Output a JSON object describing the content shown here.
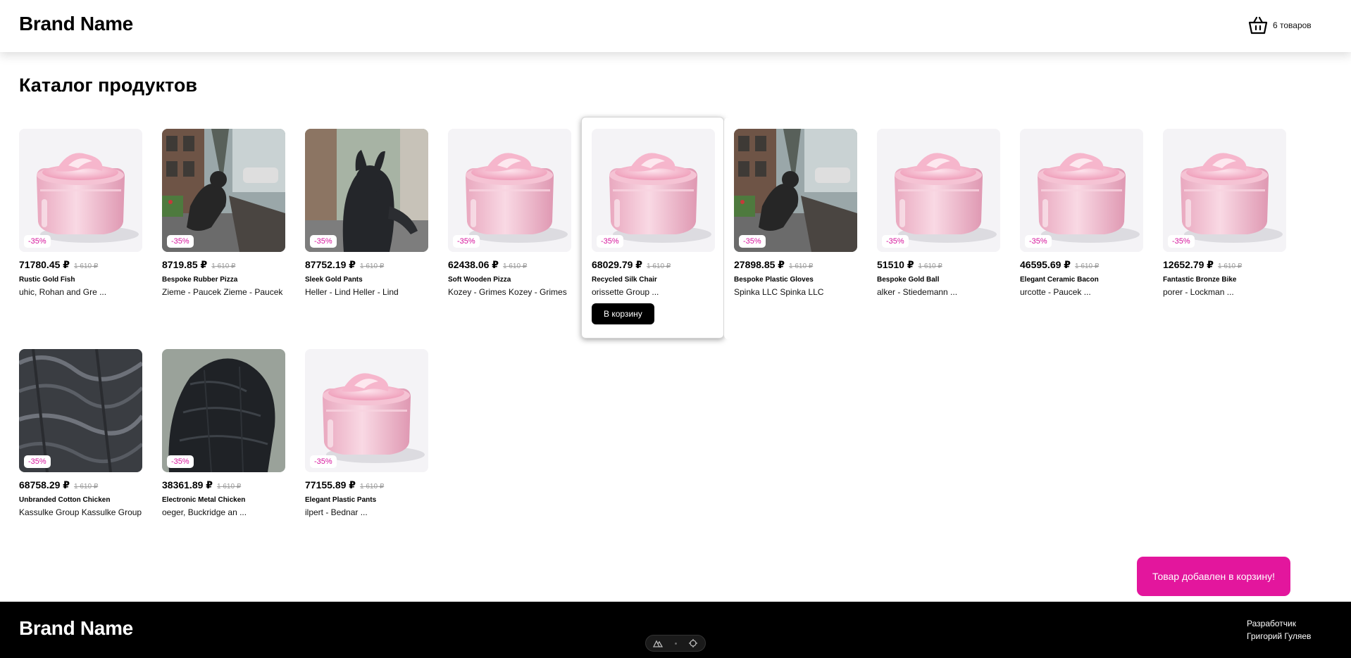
{
  "header": {
    "brand": "Brand Name",
    "cart_count": "6 товаров",
    "cart_icon": "basket-icon"
  },
  "page": {
    "title": "Каталог продуктов"
  },
  "products": [
    {
      "price": "71780.45 ₽",
      "old_price": "1 610 ₽",
      "discount": "-35%",
      "name": "Rustic Gold Fish",
      "vendor": "uhic, Rohan and Gre ...",
      "image": "cream-jar"
    },
    {
      "price": "8719.85 ₽",
      "old_price": "1 610 ₽",
      "discount": "-35%",
      "name": "Bespoke Rubber Pizza",
      "vendor": "Zieme - Paucek Zieme - Paucek",
      "image": "statue-street"
    },
    {
      "price": "87752.19 ₽",
      "old_price": "1 610 ₽",
      "discount": "-35%",
      "name": "Sleek Gold Pants",
      "vendor": "Heller - Lind Heller - Lind",
      "image": "statue-close"
    },
    {
      "price": "62438.06 ₽",
      "old_price": "1 610 ₽",
      "discount": "-35%",
      "name": "Soft Wooden Pizza",
      "vendor": "Kozey - Grimes Kozey - Grimes",
      "image": "cream-jar"
    },
    {
      "price": "68029.79 ₽",
      "old_price": "1 610 ₽",
      "discount": "-35%",
      "name": "Recycled Silk Chair",
      "vendor": "orissette Group ...",
      "image": "cream-jar",
      "button": "В корзину"
    },
    {
      "price": "27898.85 ₽",
      "old_price": "1 610 ₽",
      "discount": "-35%",
      "name": "Bespoke Plastic Gloves",
      "vendor": "Spinka LLC Spinka LLC",
      "image": "statue-street"
    },
    {
      "price": "51510 ₽",
      "old_price": "1 610 ₽",
      "discount": "-35%",
      "name": "Bespoke Gold Ball",
      "vendor": "alker - Stiedemann ...",
      "image": "cream-jar"
    },
    {
      "price": "46595.69 ₽",
      "old_price": "1 610 ₽",
      "discount": "-35%",
      "name": "Elegant Ceramic Bacon",
      "vendor": "urcotte - Paucek ...",
      "image": "cream-jar"
    },
    {
      "price": "12652.79 ₽",
      "old_price": "1 610 ₽",
      "discount": "-35%",
      "name": "Fantastic Bronze Bike",
      "vendor": "porer - Lockman ...",
      "image": "cream-jar"
    },
    {
      "price": "68758.29 ₽",
      "old_price": "1 610 ₽",
      "discount": "-35%",
      "name": "Unbranded Cotton Chicken",
      "vendor": "Kassulke Group Kassulke Group",
      "image": "texture-dark"
    },
    {
      "price": "38361.89 ₽",
      "old_price": "1 610 ₽",
      "discount": "-35%",
      "name": "Electronic Metal Chicken",
      "vendor": "oeger, Buckridge an ...",
      "image": "texture-fur"
    },
    {
      "price": "77155.89 ₽",
      "old_price": "1 610 ₽",
      "discount": "-35%",
      "name": "Elegant Plastic Pants",
      "vendor": "ilpert - Bednar ...",
      "image": "cream-jar"
    }
  ],
  "toast": {
    "message": "Товар добавлен в корзину!",
    "color": "#e3169d"
  },
  "footer": {
    "brand": "Brand Name",
    "dev_label": "Разработчик",
    "dev_name": "Григорий Гуляев"
  },
  "colors": {
    "accent": "#e3169d",
    "button": "#000000"
  }
}
